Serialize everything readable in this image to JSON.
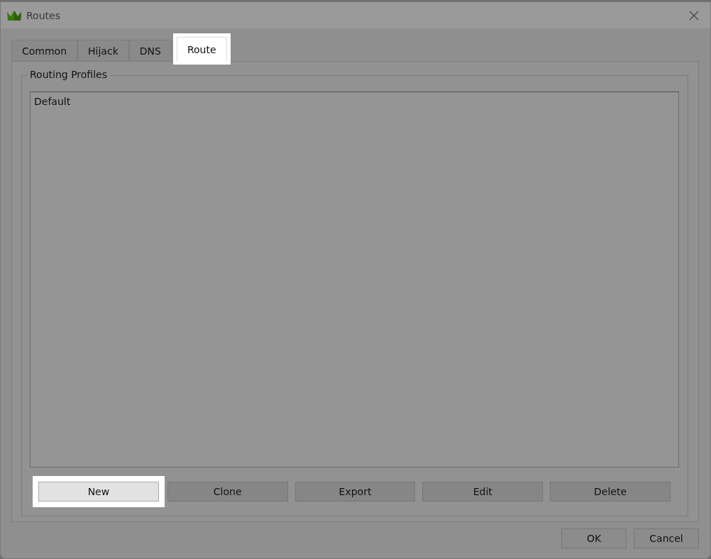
{
  "window": {
    "title": "Routes"
  },
  "tabs": [
    {
      "label": "Common",
      "selected": false,
      "highlighted": false
    },
    {
      "label": "Hijack",
      "selected": false,
      "highlighted": false
    },
    {
      "label": "DNS",
      "selected": false,
      "highlighted": false
    },
    {
      "label": "Route",
      "selected": true,
      "highlighted": true
    }
  ],
  "group": {
    "title": "Routing Profiles",
    "profiles": [
      {
        "name": "Default"
      }
    ]
  },
  "actions": [
    {
      "label": "New",
      "highlighted": true
    },
    {
      "label": "Clone",
      "highlighted": false
    },
    {
      "label": "Export",
      "highlighted": false
    },
    {
      "label": "Edit",
      "highlighted": false
    },
    {
      "label": "Delete",
      "highlighted": false
    }
  ],
  "buttons": [
    {
      "label": "OK"
    },
    {
      "label": "Cancel"
    }
  ]
}
